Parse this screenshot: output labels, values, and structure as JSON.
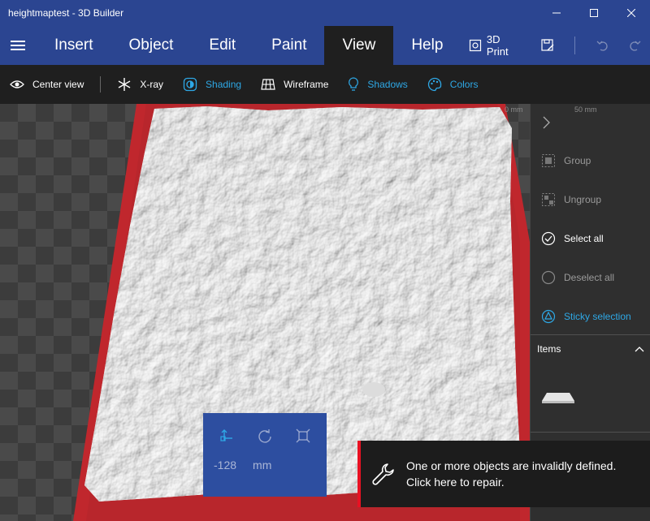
{
  "window": {
    "title": "heightmaptest - 3D Builder"
  },
  "menu": {
    "items": [
      "Insert",
      "Object",
      "Edit",
      "Paint",
      "View",
      "Help"
    ],
    "active": "View",
    "print_label": "3D Print"
  },
  "toolbar": {
    "center_view": "Center view",
    "xray": "X-ray",
    "shading": "Shading",
    "wireframe": "Wireframe",
    "shadows": "Shadows",
    "colors": "Colors"
  },
  "rulers": {
    "zero": "0 mm",
    "fifty": "50 mm"
  },
  "panel": {
    "group": "Group",
    "ungroup": "Ungroup",
    "select_all": "Select all",
    "deselect_all": "Deselect all",
    "sticky_selection": "Sticky selection",
    "items_header": "Items"
  },
  "transform": {
    "value": "-128",
    "unit": "mm"
  },
  "notification": {
    "line1": "One or more objects are invalidly defined.",
    "line2": "Click here to repair."
  },
  "colors": {
    "titlebar": "#2b4591",
    "accent": "#2ea8e6",
    "plate": "#c0272d",
    "error": "#e81123"
  }
}
